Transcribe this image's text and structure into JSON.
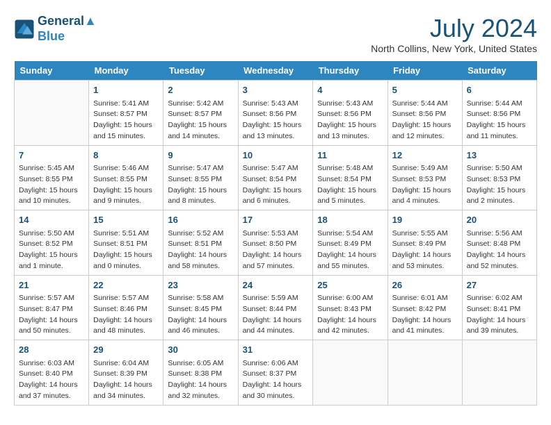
{
  "header": {
    "logo_line1": "General",
    "logo_line2": "Blue",
    "month_title": "July 2024",
    "location": "North Collins, New York, United States"
  },
  "weekdays": [
    "Sunday",
    "Monday",
    "Tuesday",
    "Wednesday",
    "Thursday",
    "Friday",
    "Saturday"
  ],
  "weeks": [
    [
      {
        "day": "",
        "info": ""
      },
      {
        "day": "1",
        "info": "Sunrise: 5:41 AM\nSunset: 8:57 PM\nDaylight: 15 hours\nand 15 minutes."
      },
      {
        "day": "2",
        "info": "Sunrise: 5:42 AM\nSunset: 8:57 PM\nDaylight: 15 hours\nand 14 minutes."
      },
      {
        "day": "3",
        "info": "Sunrise: 5:43 AM\nSunset: 8:56 PM\nDaylight: 15 hours\nand 13 minutes."
      },
      {
        "day": "4",
        "info": "Sunrise: 5:43 AM\nSunset: 8:56 PM\nDaylight: 15 hours\nand 13 minutes."
      },
      {
        "day": "5",
        "info": "Sunrise: 5:44 AM\nSunset: 8:56 PM\nDaylight: 15 hours\nand 12 minutes."
      },
      {
        "day": "6",
        "info": "Sunrise: 5:44 AM\nSunset: 8:56 PM\nDaylight: 15 hours\nand 11 minutes."
      }
    ],
    [
      {
        "day": "7",
        "info": "Sunrise: 5:45 AM\nSunset: 8:55 PM\nDaylight: 15 hours\nand 10 minutes."
      },
      {
        "day": "8",
        "info": "Sunrise: 5:46 AM\nSunset: 8:55 PM\nDaylight: 15 hours\nand 9 minutes."
      },
      {
        "day": "9",
        "info": "Sunrise: 5:47 AM\nSunset: 8:55 PM\nDaylight: 15 hours\nand 8 minutes."
      },
      {
        "day": "10",
        "info": "Sunrise: 5:47 AM\nSunset: 8:54 PM\nDaylight: 15 hours\nand 6 minutes."
      },
      {
        "day": "11",
        "info": "Sunrise: 5:48 AM\nSunset: 8:54 PM\nDaylight: 15 hours\nand 5 minutes."
      },
      {
        "day": "12",
        "info": "Sunrise: 5:49 AM\nSunset: 8:53 PM\nDaylight: 15 hours\nand 4 minutes."
      },
      {
        "day": "13",
        "info": "Sunrise: 5:50 AM\nSunset: 8:53 PM\nDaylight: 15 hours\nand 2 minutes."
      }
    ],
    [
      {
        "day": "14",
        "info": "Sunrise: 5:50 AM\nSunset: 8:52 PM\nDaylight: 15 hours\nand 1 minute."
      },
      {
        "day": "15",
        "info": "Sunrise: 5:51 AM\nSunset: 8:51 PM\nDaylight: 15 hours\nand 0 minutes."
      },
      {
        "day": "16",
        "info": "Sunrise: 5:52 AM\nSunset: 8:51 PM\nDaylight: 14 hours\nand 58 minutes."
      },
      {
        "day": "17",
        "info": "Sunrise: 5:53 AM\nSunset: 8:50 PM\nDaylight: 14 hours\nand 57 minutes."
      },
      {
        "day": "18",
        "info": "Sunrise: 5:54 AM\nSunset: 8:49 PM\nDaylight: 14 hours\nand 55 minutes."
      },
      {
        "day": "19",
        "info": "Sunrise: 5:55 AM\nSunset: 8:49 PM\nDaylight: 14 hours\nand 53 minutes."
      },
      {
        "day": "20",
        "info": "Sunrise: 5:56 AM\nSunset: 8:48 PM\nDaylight: 14 hours\nand 52 minutes."
      }
    ],
    [
      {
        "day": "21",
        "info": "Sunrise: 5:57 AM\nSunset: 8:47 PM\nDaylight: 14 hours\nand 50 minutes."
      },
      {
        "day": "22",
        "info": "Sunrise: 5:57 AM\nSunset: 8:46 PM\nDaylight: 14 hours\nand 48 minutes."
      },
      {
        "day": "23",
        "info": "Sunrise: 5:58 AM\nSunset: 8:45 PM\nDaylight: 14 hours\nand 46 minutes."
      },
      {
        "day": "24",
        "info": "Sunrise: 5:59 AM\nSunset: 8:44 PM\nDaylight: 14 hours\nand 44 minutes."
      },
      {
        "day": "25",
        "info": "Sunrise: 6:00 AM\nSunset: 8:43 PM\nDaylight: 14 hours\nand 42 minutes."
      },
      {
        "day": "26",
        "info": "Sunrise: 6:01 AM\nSunset: 8:42 PM\nDaylight: 14 hours\nand 41 minutes."
      },
      {
        "day": "27",
        "info": "Sunrise: 6:02 AM\nSunset: 8:41 PM\nDaylight: 14 hours\nand 39 minutes."
      }
    ],
    [
      {
        "day": "28",
        "info": "Sunrise: 6:03 AM\nSunset: 8:40 PM\nDaylight: 14 hours\nand 37 minutes."
      },
      {
        "day": "29",
        "info": "Sunrise: 6:04 AM\nSunset: 8:39 PM\nDaylight: 14 hours\nand 34 minutes."
      },
      {
        "day": "30",
        "info": "Sunrise: 6:05 AM\nSunset: 8:38 PM\nDaylight: 14 hours\nand 32 minutes."
      },
      {
        "day": "31",
        "info": "Sunrise: 6:06 AM\nSunset: 8:37 PM\nDaylight: 14 hours\nand 30 minutes."
      },
      {
        "day": "",
        "info": ""
      },
      {
        "day": "",
        "info": ""
      },
      {
        "day": "",
        "info": ""
      }
    ]
  ]
}
